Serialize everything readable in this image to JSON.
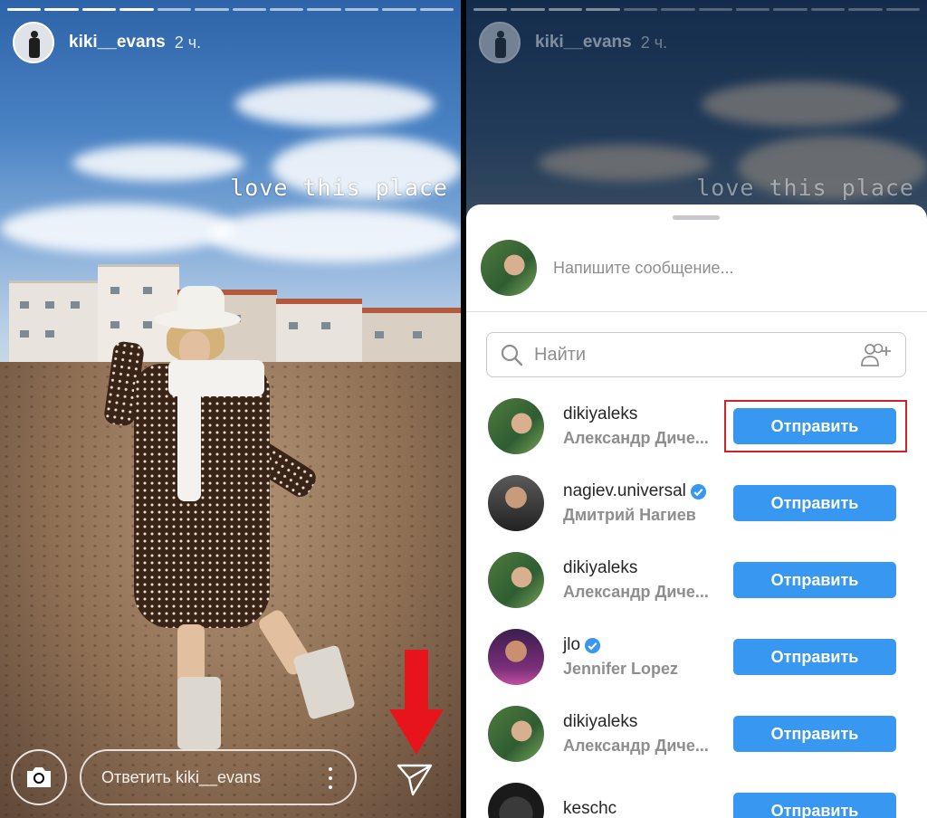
{
  "story": {
    "username": "kiki__evans",
    "time": "2 ч.",
    "overlay_text": "love this place",
    "reply_placeholder": "Ответить kiki__evans",
    "progress_segments": 12,
    "progress_done": 4
  },
  "share_sheet": {
    "message_placeholder": "Напишите сообщение...",
    "search_placeholder": "Найти",
    "contacts": [
      {
        "username": "dikiyaleks",
        "subtitle": "Александр Диче...",
        "verified": false,
        "button": "Отправить",
        "highlighted": true
      },
      {
        "username": "nagiev.universal",
        "subtitle": "Дмитрий Нагиев",
        "verified": true,
        "button": "Отправить",
        "highlighted": false
      },
      {
        "username": "dikiyaleks",
        "subtitle": "Александр Диче...",
        "verified": false,
        "button": "Отправить",
        "highlighted": false
      },
      {
        "username": "jlo",
        "subtitle": "Jennifer Lopez",
        "verified": true,
        "button": "Отправить",
        "highlighted": false
      },
      {
        "username": "dikiyaleks",
        "subtitle": "Александр Диче...",
        "verified": false,
        "button": "Отправить",
        "highlighted": false
      },
      {
        "username": "keschc",
        "subtitle": "",
        "verified": false,
        "button": "Отправить",
        "highlighted": false
      }
    ]
  },
  "colors": {
    "send_button": "#3897f0",
    "highlight_box": "#d0202a",
    "annotation_arrow": "#e8141c",
    "verified_badge": "#3897f0"
  },
  "icons": {
    "camera": "camera-icon",
    "send": "paper-plane-icon",
    "more": "vertical-dots-icon",
    "search": "search-icon",
    "add_people": "add-people-icon",
    "verified": "verified-badge-icon"
  }
}
